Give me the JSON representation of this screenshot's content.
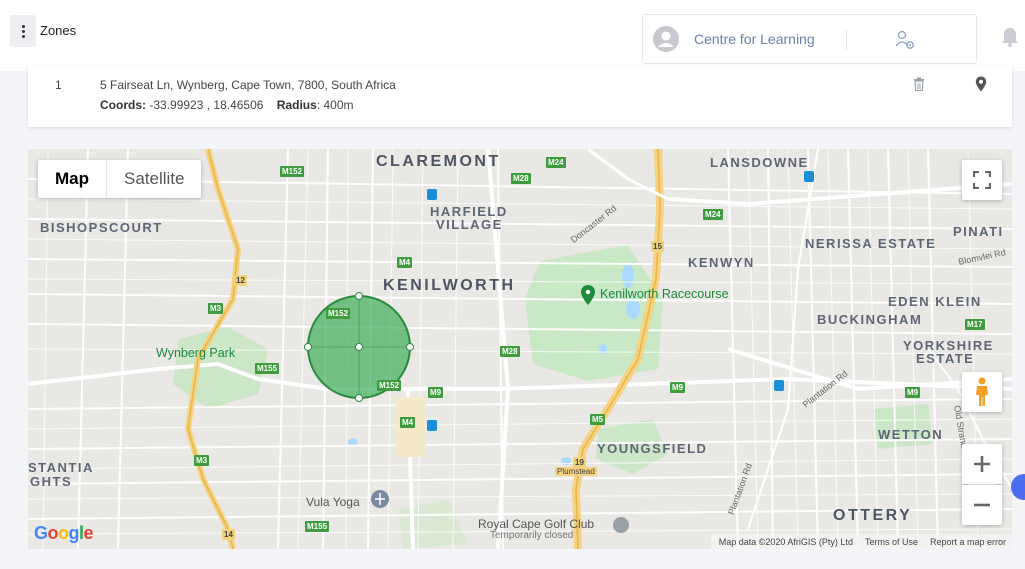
{
  "header": {
    "title": "Zones",
    "org_name": "Centre for Learning"
  },
  "zones": [
    {
      "number": "1",
      "address": "5 Fairseat Ln, Wynberg, Cape Town, 7800, South Africa",
      "coords_label": "Coords:",
      "coords_value": "-33.99923 , 18.46506",
      "radius_label": "Radius",
      "radius_value": ": 400m"
    }
  ],
  "map": {
    "type_buttons": [
      "Map",
      "Satellite"
    ],
    "selected_type": "Map",
    "attribution": {
      "data": "Map data ©2020 AfriGIS (Pty) Ltd",
      "terms": "Terms of Use",
      "report": "Report a map error"
    },
    "areas": [
      "CLAREMONT",
      "LANSDOWNE",
      "HARFIELD",
      "VILLAGE",
      "BISHOPSCOURT",
      "KENILWORTH",
      "NERISSA ESTATE",
      "PINATI",
      "KENWYN",
      "EDEN KLEIN",
      "BUCKINGHAM",
      "YORKSHIRE",
      "ESTATE",
      "YOUNGSFIELD",
      "WETTON",
      "OTTERY",
      "STANTIA",
      "GHTS"
    ],
    "places": [
      "Kenilworth Racecourse",
      "Wynberg Park",
      "Vula Yoga",
      "Royal Cape Golf Club",
      "Temporarily closed"
    ],
    "roads": [
      "Doncaster Rd",
      "Blomvlei Rd",
      "Plantation Rd",
      "Old Strandfo...",
      "Plumstead"
    ],
    "route_shields": [
      "M152",
      "M24",
      "M28",
      "M3",
      "12",
      "M4",
      "15",
      "M24",
      "M152",
      "M155",
      "M152",
      "M28",
      "M9",
      "M9",
      "M17",
      "M9",
      "M4",
      "M5",
      "M3",
      "19",
      "M155",
      "14"
    ],
    "zone_circle": {
      "radius": "400m",
      "color": "#3fae5a"
    }
  }
}
